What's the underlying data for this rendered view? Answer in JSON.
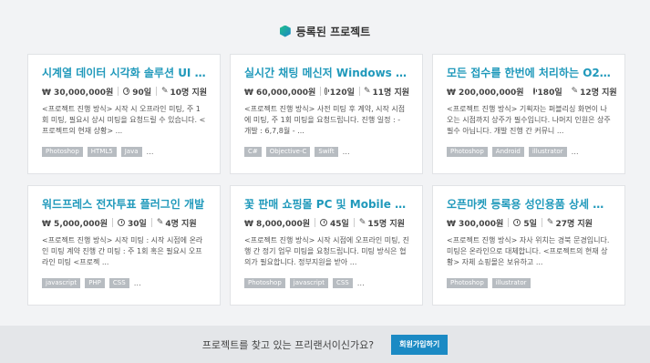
{
  "section": {
    "title": "등록된 프로젝트"
  },
  "projects": [
    {
      "title": "시계열 데이터 시각화 솔루션 UI 및 …",
      "budget": "₩ 30,000,000원",
      "days": "90일",
      "applicants": "10명 지원",
      "description": "<프로젝트 진행 방식> 시작 시 오프라인 미팅, 주 1회 미팅, 필요시 상시 미팅을 요청드릴 수 있습니다. <프로젝트의 현재 상황> ...",
      "tags": [
        "Photoshop",
        "HTML5",
        "Java"
      ],
      "more": "…"
    },
    {
      "title": "실시간 채팅 메신저 Windows 및 …",
      "budget": "₩ 60,000,000원",
      "days": "120일",
      "applicants": "11명 지원",
      "description": "<프로젝트 진행 방식> 사전 미팅 후 계약, 시작 시점에 미팅, 주 1회 미팅을 요청드립니다. 진행 일정 : - 개발 : 6,7,8월 - ...",
      "tags": [
        "C#",
        "Objective-C",
        "Swift"
      ],
      "more": "…"
    },
    {
      "title": "모든 접수를 한번에 처리하는 O2O …",
      "budget": "₩ 200,000,000원",
      "days": "180일",
      "applicants": "12명 지원",
      "description": "<프로젝트 진행 방식> 기획자는 퍼블리싱 화면이 나오는 시점까지 상주가 필수입니다. 나머지 인원은 상주 필수 아닙니다. 개발 진행 간 커뮤니 ...",
      "tags": [
        "Photoshop",
        "Android",
        "illustrator"
      ],
      "more": "…"
    },
    {
      "title": "워드프레스 전자투표 플러그인 개발",
      "budget": "₩ 5,000,000원",
      "days": "30일",
      "applicants": "4명 지원",
      "description": "<프로젝트 진행 방식> 시작 미팅 : 시작 시점에 온라인 미팅 계약 진행 간 미팅 : 주 1회 혹은 필요시 오프라인 미팅 <프로젝 ...",
      "tags": [
        "javascript",
        "PHP",
        "CSS"
      ],
      "more": "…"
    },
    {
      "title": "꽃 판매 쇼핑몰 PC 및 Mobile 웹 제작",
      "budget": "₩ 8,000,000원",
      "days": "45일",
      "applicants": "15명 지원",
      "description": "<프로젝트 진행 방식> 시작 시점에 오프라인 미팅, 진행 간 정기 업무 미팅을 요청드립니다. 미팅 방식은 협의가 필요합니다. 정부지원을 받아 ...",
      "tags": [
        "Photoshop",
        "javascript",
        "CSS"
      ],
      "more": "…"
    },
    {
      "title": "오픈마켓 등록용 성인용품 상세 페…",
      "budget": "₩ 300,000원",
      "days": "5일",
      "applicants": "27명 지원",
      "description": "<프로젝트 진행 방식> 자사 위치는 경북 문경입니다. 미팅은 온라인으로 대체합니다. <프로젝트의 현재 상황> 자체 쇼핑몰은 보유하고 ...",
      "tags": [
        "Photoshop",
        "illustrator"
      ],
      "more": ""
    }
  ],
  "footer": {
    "cta_text": "프로젝트를 찾고 있는 프리랜서이신가요?",
    "signup_label": "회원가입하기"
  },
  "icons": {
    "section_logo": "hexagon-logo-icon",
    "budget": "won-icon",
    "duration": "clock-icon",
    "applicants": "pencil-icon"
  },
  "colors": {
    "title_link": "#2099bb",
    "signup_button": "#1b8ac4",
    "tag_bg": "#b7bcc1",
    "footer_bg": "#e4e6e9"
  }
}
